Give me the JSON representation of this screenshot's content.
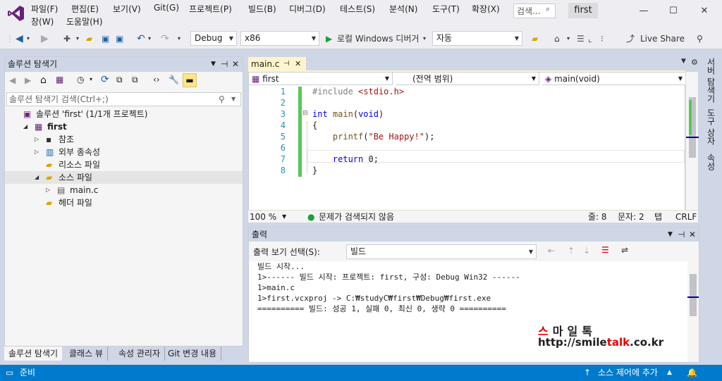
{
  "menu": {
    "row1": [
      "파일(F)",
      "편집(E)",
      "보기(V)",
      "Git(G)",
      "프로젝트(P)",
      "빌드(B)",
      "디버그(D)",
      "테스트(S)",
      "분석(N)",
      "도구(T)",
      "확장(X)"
    ],
    "row2": [
      "창(W)",
      "도움말(H)"
    ],
    "search_placeholder": "검색...",
    "project_name": "first"
  },
  "window_controls": {
    "minimize": "—",
    "maximize": "☐",
    "close": "✕"
  },
  "toolbar": {
    "config": "Debug",
    "platform": "x86",
    "run_label": "로컬 Windows 디버거",
    "run_mode": "자동",
    "live_share": "Live Share"
  },
  "solution_explorer": {
    "title": "솔루션 탐색기",
    "search_placeholder": "솔루션 탐색기 검색(Ctrl+;)",
    "tree": [
      {
        "label": "솔루션 'first' (1/1개 프로젝트)",
        "level": 0,
        "twisty": "",
        "icon": "solution-icon"
      },
      {
        "label": "first",
        "level": 1,
        "twisty": "◢",
        "icon": "cpp-project-icon",
        "bold": true
      },
      {
        "label": "참조",
        "level": 2,
        "twisty": "▷",
        "icon": "references-icon"
      },
      {
        "label": "외부 종속성",
        "level": 2,
        "twisty": "▷",
        "icon": "external-deps-icon"
      },
      {
        "label": "리소스 파일",
        "level": 2,
        "twisty": "",
        "icon": "filter-folder-icon"
      },
      {
        "label": "소스 파일",
        "level": 2,
        "twisty": "◢",
        "icon": "filter-folder-icon",
        "selected": true
      },
      {
        "label": "main.c",
        "level": 3,
        "twisty": "▷",
        "icon": "c-file-icon"
      },
      {
        "label": "헤더 파일",
        "level": 2,
        "twisty": "",
        "icon": "filter-folder-icon"
      }
    ],
    "tabs": [
      "솔루션 탐색기",
      "클래스 뷰",
      "속성 관리자",
      "Git 변경 내용"
    ]
  },
  "editor": {
    "tab_label": "main.c",
    "nav_project": "first",
    "nav_scope": "(전역 범위)",
    "nav_member": "main(void)",
    "lines": [
      {
        "n": "1",
        "text": "#include <stdio.h>"
      },
      {
        "n": "2",
        "text": ""
      },
      {
        "n": "3",
        "text": "int main(void)"
      },
      {
        "n": "4",
        "text": "{"
      },
      {
        "n": "5",
        "text": "    printf(\"Be Happy!\");"
      },
      {
        "n": "6",
        "text": ""
      },
      {
        "n": "7",
        "text": "    return 0;"
      },
      {
        "n": "8",
        "text": "}"
      }
    ],
    "zoom": "100 %",
    "issues": "문제가 검색되지 않음",
    "line_info": "줄: 8",
    "col_info": "문자: 2",
    "tab_mode": "탭",
    "eol": "CRLF"
  },
  "right_rail": [
    "서버 탐색기",
    "도구 상자",
    "속성"
  ],
  "output": {
    "title": "출력",
    "show_from_label": "출력 보기 선택(S):",
    "show_from_value": "빌드",
    "lines": [
      "빌드 시작...",
      "1>------ 빌드 시작: 프로젝트: first, 구성: Debug Win32 ------",
      "1>main.c",
      "1>first.vcxproj -> C:₩studyC₩first₩Debug₩first.exe",
      "========== 빌드: 성공 1, 실패 0, 최신 0, 생략 0 =========="
    ]
  },
  "watermark": {
    "title_chars": [
      "스",
      "마",
      "일",
      "톡"
    ],
    "url_pre": "http://smile",
    "url_mid": "talk",
    "url_post": ".co.kr"
  },
  "statusbar": {
    "ready": "준비",
    "source_control": "소스 제어에 추가"
  },
  "colors": {
    "accent": "#007acc",
    "logo": "#68217a",
    "tab_active": "#fff5cc",
    "change_bar": "#57c957"
  }
}
